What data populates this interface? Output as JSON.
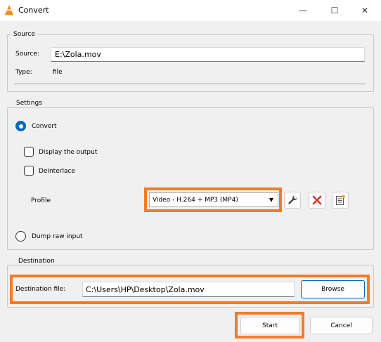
{
  "window": {
    "title": "Convert",
    "minimize_glyph": "—",
    "maximize_glyph": "☐",
    "close_glyph": "✕",
    "app_icon": "vlc-cone-icon"
  },
  "source": {
    "group_title": "Source",
    "source_label": "Source:",
    "source_value": "E:\\Zola.mov",
    "type_label": "Type:",
    "type_value": "file"
  },
  "settings": {
    "group_title": "Settings",
    "convert_label": "Convert",
    "convert_selected": true,
    "display_output_label": "Display the output",
    "display_output_checked": false,
    "deinterlace_label": "Deinterlace",
    "deinterlace_checked": false,
    "profile_label": "Profile",
    "profile_selected": "Video - H.264 + MP3 (MP4)",
    "dump_raw_label": "Dump raw input",
    "dump_raw_selected": false,
    "icons": [
      "wrench-icon",
      "delete-x-icon",
      "new-profile-icon"
    ]
  },
  "destination": {
    "group_title": "Destination",
    "file_label": "Destination file:",
    "file_value": "C:\\Users\\HP\\Desktop\\Zola.mov",
    "browse_label": "Browse"
  },
  "actions": {
    "start_label": "Start",
    "cancel_label": "Cancel"
  },
  "colors": {
    "highlight": "#f07d2a",
    "accent": "#0067c0",
    "delete_red": "#d9342b"
  }
}
